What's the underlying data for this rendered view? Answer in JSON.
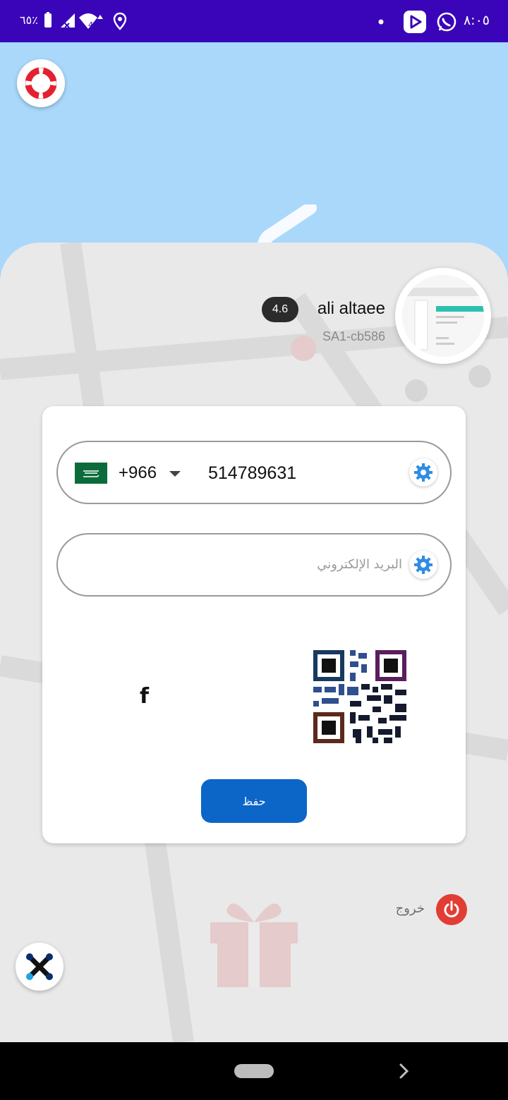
{
  "status_bar": {
    "time": "٨:٠٥",
    "battery_percent": "٦٥٪",
    "signal_label": "4"
  },
  "profile": {
    "name": "ali altaee",
    "rating": "4.6",
    "code": "SA1-cb586"
  },
  "form": {
    "country_code": "+966",
    "phone": "514789631",
    "email_placeholder": "البريد الإلكتروني",
    "save_label": "حفظ"
  },
  "social": {
    "facebook_glyph": "f"
  },
  "logout": {
    "label": "خروج"
  },
  "colors": {
    "status_bar": "#3a05b8",
    "map_water": "#a9d8fb",
    "save_button": "#0b66c8",
    "logout_red": "#e23d34",
    "gear_blue": "#2f8de4"
  },
  "icons": [
    "help-lifebuoy-icon",
    "gear-icon",
    "facebook-icon",
    "qr-code-icon",
    "power-icon",
    "app-logo-icon",
    "gift-icon",
    "whatsapp-icon",
    "play-icon",
    "location-icon",
    "wifi-icon",
    "battery-icon"
  ]
}
